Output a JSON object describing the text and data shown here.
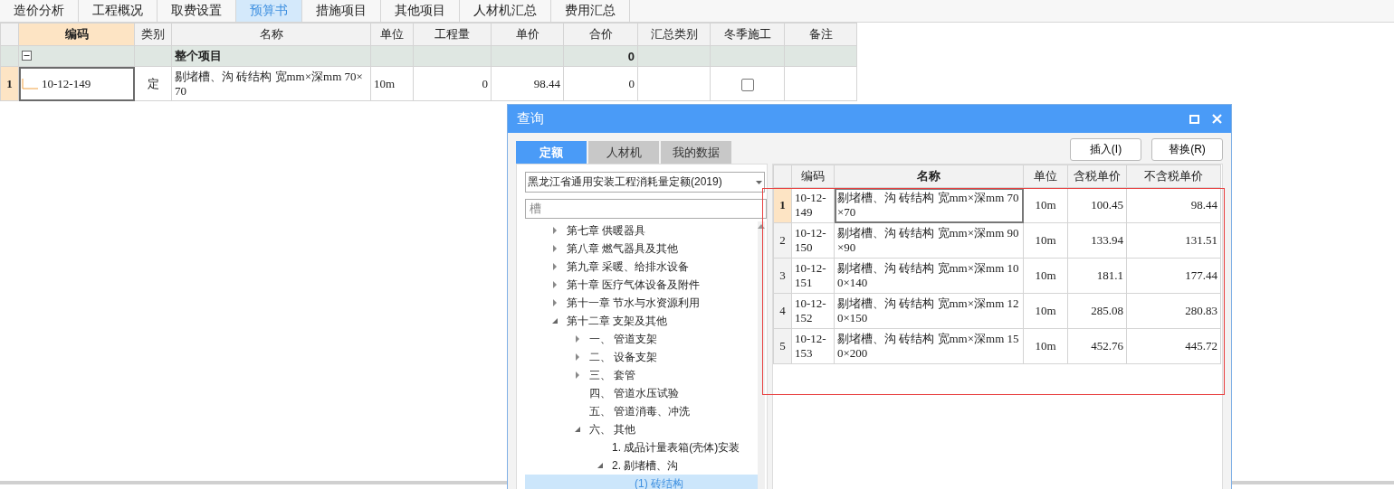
{
  "top_tabs": [
    {
      "label": "造价分析",
      "selected": false
    },
    {
      "label": "工程概况",
      "selected": false
    },
    {
      "label": "取费设置",
      "selected": false
    },
    {
      "label": "预算书",
      "selected": true
    },
    {
      "label": "措施项目",
      "selected": false
    },
    {
      "label": "其他项目",
      "selected": false
    },
    {
      "label": "人材机汇总",
      "selected": false
    },
    {
      "label": "费用汇总",
      "selected": false
    }
  ],
  "main_table": {
    "columns": [
      {
        "label": "编码",
        "selected": true
      },
      {
        "label": "类别",
        "selected": false
      },
      {
        "label": "名称",
        "selected": false
      },
      {
        "label": "单位",
        "selected": false
      },
      {
        "label": "工程量",
        "selected": false
      },
      {
        "label": "单价",
        "selected": false
      },
      {
        "label": "合价",
        "selected": false
      },
      {
        "label": "汇总类别",
        "selected": false
      },
      {
        "label": "冬季施工",
        "selected": false
      },
      {
        "label": "备注",
        "selected": false
      }
    ],
    "group_row": {
      "expanded": true,
      "name": "整个项目",
      "total": "0"
    },
    "rows": [
      {
        "index": "1",
        "code": "10-12-149",
        "type": "定",
        "name": "剔堵槽、沟 砖结构 宽mm×深mm 70×70",
        "unit": "10m",
        "quantity": "0",
        "unit_price": "98.44",
        "total": "0",
        "winter_construction": false,
        "selected": true
      }
    ]
  },
  "dialog": {
    "title": "查询",
    "tabs": [
      {
        "label": "定额",
        "selected": true
      },
      {
        "label": "人材机",
        "selected": false
      },
      {
        "label": "我的数据",
        "selected": false
      }
    ],
    "buttons": [
      "插入(I)",
      "替换(R)"
    ],
    "library_select": {
      "value": "黑龙江省通用安装工程消耗量定额(2019)"
    },
    "search": {
      "value": "槽"
    },
    "tree": [
      {
        "label": "第七章 供暖器具",
        "kind": "folder",
        "expanded": false,
        "selected": false
      },
      {
        "label": "第八章 燃气器具及其他",
        "kind": "folder",
        "expanded": false,
        "selected": false
      },
      {
        "label": "第九章 采暖、给排水设备",
        "kind": "folder",
        "expanded": false,
        "selected": false
      },
      {
        "label": "第十章 医疗气体设备及附件",
        "kind": "folder",
        "expanded": false,
        "selected": false
      },
      {
        "label": "第十一章 节水与水资源利用",
        "kind": "folder",
        "expanded": false,
        "selected": false
      },
      {
        "label": "第十二章 支架及其他",
        "kind": "folder",
        "expanded": true,
        "selected": false,
        "children": [
          {
            "label": "一、 管道支架",
            "kind": "folder",
            "expanded": false,
            "selected": false
          },
          {
            "label": "二、 设备支架",
            "kind": "folder",
            "expanded": false,
            "selected": false
          },
          {
            "label": "三、 套管",
            "kind": "folder",
            "expanded": false,
            "selected": false
          },
          {
            "label": "四、 管道水压试验",
            "kind": "leaf",
            "selected": false
          },
          {
            "label": "五、 管道消毒、冲洗",
            "kind": "leaf",
            "selected": false
          },
          {
            "label": "六、 其他",
            "kind": "folder",
            "expanded": true,
            "selected": false,
            "children": [
              {
                "label": "1. 成品计量表箱(壳体)安装",
                "kind": "leaf",
                "selected": false
              },
              {
                "label": "2. 剔堵槽、沟",
                "kind": "folder",
                "expanded": true,
                "selected": false,
                "children": [
                  {
                    "label": "(1) 砖结构",
                    "kind": "leaf",
                    "selected": true
                  }
                ]
              }
            ]
          }
        ]
      }
    ],
    "results": {
      "columns": [
        {
          "label": "编码",
          "selected": false
        },
        {
          "label": "名称",
          "selected": true
        },
        {
          "label": "单位",
          "selected": false
        },
        {
          "label": "含税单价",
          "selected": false
        },
        {
          "label": "不含税单价",
          "selected": false
        }
      ],
      "rows": [
        {
          "index": "1",
          "code": "10-12-149",
          "name": "剔堵槽、沟 砖结构 宽mm×深mm 70×70",
          "unit": "10m",
          "price_with_tax": "100.45",
          "price_without_tax": "98.44",
          "selected": true
        },
        {
          "index": "2",
          "code": "10-12-150",
          "name": "剔堵槽、沟 砖结构 宽mm×深mm 90×90",
          "unit": "10m",
          "price_with_tax": "133.94",
          "price_without_tax": "131.51",
          "selected": false
        },
        {
          "index": "3",
          "code": "10-12-151",
          "name": "剔堵槽、沟 砖结构 宽mm×深mm 100×140",
          "unit": "10m",
          "price_with_tax": "181.1",
          "price_without_tax": "177.44",
          "selected": false
        },
        {
          "index": "4",
          "code": "10-12-152",
          "name": "剔堵槽、沟 砖结构 宽mm×深mm 120×150",
          "unit": "10m",
          "price_with_tax": "285.08",
          "price_without_tax": "280.83",
          "selected": false
        },
        {
          "index": "5",
          "code": "10-12-153",
          "name": "剔堵槽、沟 砖结构 宽mm×深mm 150×200",
          "unit": "10m",
          "price_with_tax": "452.76",
          "price_without_tax": "445.72",
          "selected": false
        }
      ]
    }
  }
}
